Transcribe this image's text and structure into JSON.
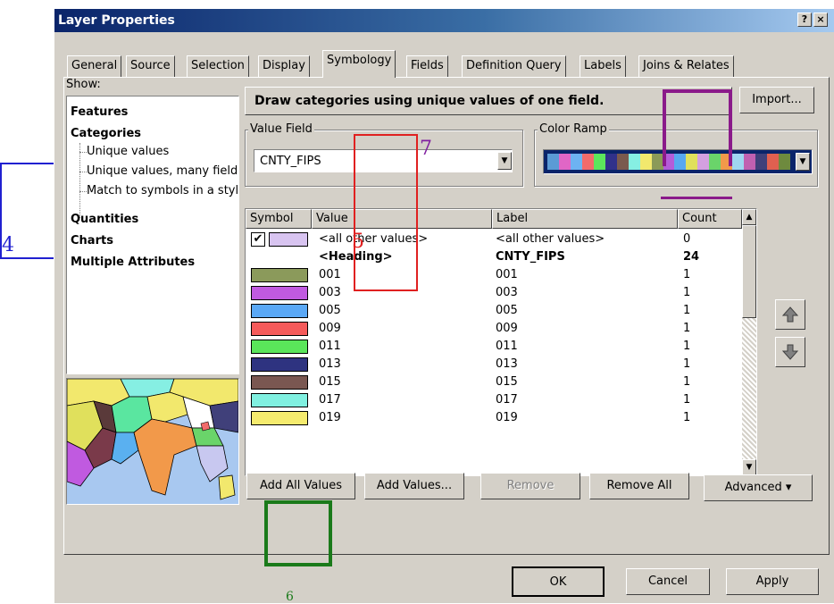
{
  "window": {
    "title": "Layer Properties",
    "help_btn": "?",
    "close_btn": "×"
  },
  "tabs": [
    {
      "label": "General"
    },
    {
      "label": "Source"
    },
    {
      "label": "Selection"
    },
    {
      "label": "Display"
    },
    {
      "label": "Symbology",
      "active": true
    },
    {
      "label": "Fields"
    },
    {
      "label": "Definition Query"
    },
    {
      "label": "Labels"
    },
    {
      "label": "Joins & Relates"
    }
  ],
  "show": {
    "label": "Show:",
    "items": [
      {
        "label": "Features"
      },
      {
        "label": "Categories"
      },
      {
        "label": "Unique values",
        "selected": true
      },
      {
        "label": "Unique values, many fields"
      },
      {
        "label": "Match to symbols in a style"
      },
      {
        "label": "Quantities"
      },
      {
        "label": "Charts"
      },
      {
        "label": "Multiple Attributes"
      }
    ]
  },
  "description": "Draw categories using unique values of one field.",
  "import_button": "Import...",
  "value_field": {
    "label": "Value Field",
    "value": "CNTY_FIPS"
  },
  "color_ramp": {
    "label": "Color Ramp",
    "colors": [
      "#5b9bd5",
      "#e066c6",
      "#6db3f2",
      "#f26b6b",
      "#5ce65c",
      "#31318a",
      "#7a5a4e",
      "#86efe3",
      "#f2e86d",
      "#8b9a58",
      "#b45cd9",
      "#57a8f0",
      "#e0e05c",
      "#d4a0e0",
      "#6ad46a",
      "#f2994a",
      "#9fd6f0",
      "#c060b0",
      "#40407a",
      "#e06050",
      "#6e8a3e"
    ]
  },
  "table": {
    "headers": {
      "symbol": "Symbol",
      "value": "Value",
      "label": "Label",
      "count": "Count"
    },
    "rows": [
      {
        "color": "#d8c4f0",
        "value": "<all other values>",
        "label": "<all other values>",
        "count": "0",
        "checked": true
      },
      {
        "color": "",
        "value": "<Heading>",
        "label": "CNTY_FIPS",
        "count": "24",
        "heading": true
      },
      {
        "color": "#8b9a5b",
        "value": "001",
        "label": "001",
        "count": "1"
      },
      {
        "color": "#c05ae0",
        "value": "003",
        "label": "003",
        "count": "1"
      },
      {
        "color": "#5aa8f5",
        "value": "005",
        "label": "005",
        "count": "1"
      },
      {
        "color": "#f55a5a",
        "value": "009",
        "label": "009",
        "count": "1"
      },
      {
        "color": "#5ae65a",
        "value": "011",
        "label": "011",
        "count": "1"
      },
      {
        "color": "#2e3380",
        "value": "013",
        "label": "013",
        "count": "1"
      },
      {
        "color": "#7a5751",
        "value": "015",
        "label": "015",
        "count": "1"
      },
      {
        "color": "#80f0e0",
        "value": "017",
        "label": "017",
        "count": "1"
      },
      {
        "color": "#f5eb6e",
        "value": "019",
        "label": "019",
        "count": "1"
      }
    ]
  },
  "buttons": {
    "add_all_values": "Add All Values",
    "add_values": "Add Values...",
    "remove": "Remove",
    "remove_all": "Remove All",
    "advanced": "Advanced ▾",
    "ok": "OK",
    "cancel": "Cancel",
    "apply": "Apply"
  },
  "annotations": [
    "4",
    "5",
    "6",
    "7"
  ]
}
